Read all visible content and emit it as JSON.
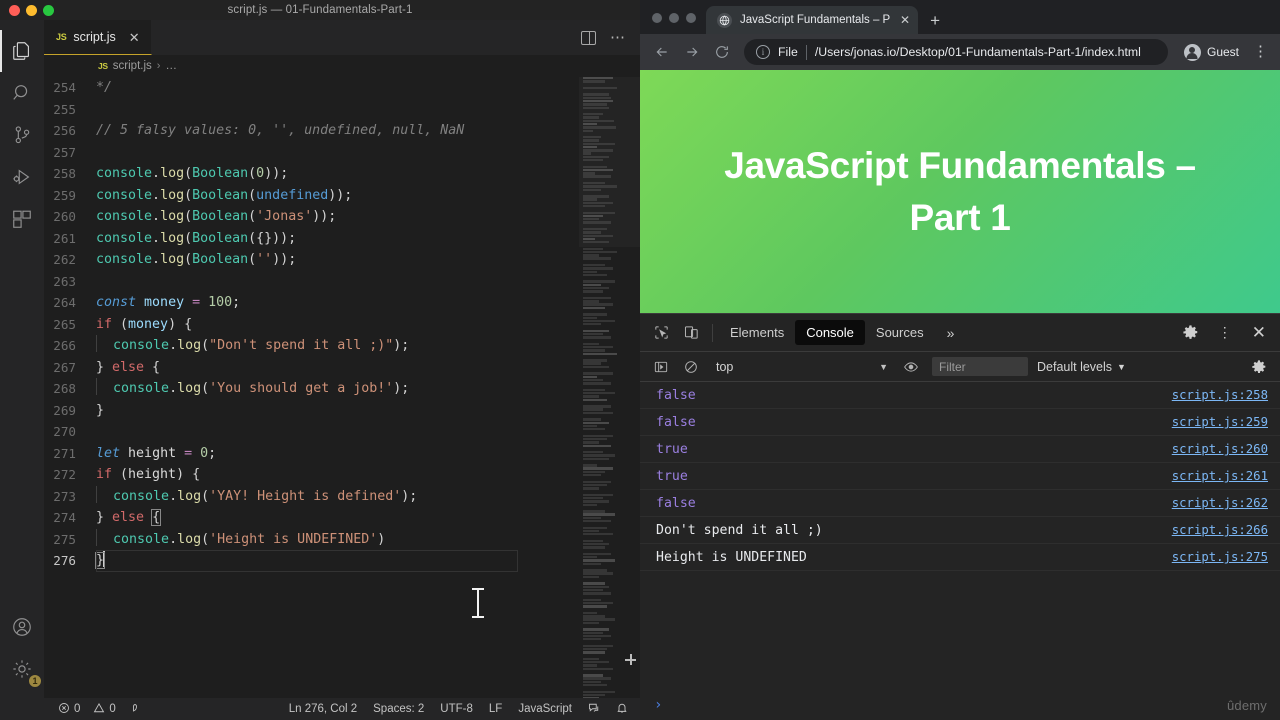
{
  "vscode": {
    "window_title": "script.js — 01-Fundamentals-Part-1",
    "tab": {
      "icon": "js-file-icon",
      "label": "script.js",
      "close": "✕"
    },
    "breadcrumb": {
      "file": "script.js",
      "separator": "›",
      "rest": "…"
    },
    "activity_items": [
      {
        "name": "explorer-icon",
        "label": "Explorer"
      },
      {
        "name": "search-icon",
        "label": "Search"
      },
      {
        "name": "source-control-icon",
        "label": "Source Control"
      },
      {
        "name": "run-debug-icon",
        "label": "Run and Debug"
      },
      {
        "name": "extensions-icon",
        "label": "Extensions"
      },
      {
        "name": "account-icon",
        "label": "Accounts"
      },
      {
        "name": "settings-gear-icon",
        "label": "Manage"
      }
    ],
    "settings_badge": "1",
    "editor_actions": {
      "split": "split-editor-icon",
      "more": "⋯"
    },
    "code": [
      {
        "n": "254",
        "tokens": [
          {
            "t": "cmt-gray",
            "v": "*/"
          }
        ]
      },
      {
        "n": "255",
        "tokens": []
      },
      {
        "n": "256",
        "tokens": [
          {
            "t": "cmt-gray",
            "v": "// 5 falsy values: 0, '', undefined, null, NaN"
          }
        ]
      },
      {
        "n": "257",
        "tokens": []
      },
      {
        "n": "258",
        "tokens": [
          {
            "t": "obj",
            "v": "console"
          },
          {
            "t": "pun",
            "v": "."
          },
          {
            "t": "fn",
            "v": "log"
          },
          {
            "t": "pun",
            "v": "("
          },
          {
            "t": "obj",
            "v": "Boolean"
          },
          {
            "t": "pun",
            "v": "("
          },
          {
            "t": "num",
            "v": "0"
          },
          {
            "t": "pun",
            "v": "));"
          }
        ]
      },
      {
        "n": "259",
        "tokens": [
          {
            "t": "obj",
            "v": "console"
          },
          {
            "t": "pun",
            "v": "."
          },
          {
            "t": "fn",
            "v": "log"
          },
          {
            "t": "pun",
            "v": "("
          },
          {
            "t": "obj",
            "v": "Boolean"
          },
          {
            "t": "pun",
            "v": "("
          },
          {
            "t": "und",
            "v": "undefined"
          },
          {
            "t": "pun",
            "v": "));"
          }
        ]
      },
      {
        "n": "260",
        "tokens": [
          {
            "t": "obj",
            "v": "console"
          },
          {
            "t": "pun",
            "v": "."
          },
          {
            "t": "fn",
            "v": "log"
          },
          {
            "t": "pun",
            "v": "("
          },
          {
            "t": "obj",
            "v": "Boolean"
          },
          {
            "t": "pun",
            "v": "("
          },
          {
            "t": "str",
            "v": "'Jonas'"
          },
          {
            "t": "pun",
            "v": "));"
          }
        ]
      },
      {
        "n": "261",
        "tokens": [
          {
            "t": "obj",
            "v": "console"
          },
          {
            "t": "pun",
            "v": "."
          },
          {
            "t": "fn",
            "v": "log"
          },
          {
            "t": "pun",
            "v": "("
          },
          {
            "t": "obj",
            "v": "Boolean"
          },
          {
            "t": "pun",
            "v": "({}));"
          }
        ]
      },
      {
        "n": "262",
        "tokens": [
          {
            "t": "obj",
            "v": "console"
          },
          {
            "t": "pun",
            "v": "."
          },
          {
            "t": "fn",
            "v": "log"
          },
          {
            "t": "pun",
            "v": "("
          },
          {
            "t": "obj",
            "v": "Boolean"
          },
          {
            "t": "pun",
            "v": "("
          },
          {
            "t": "str",
            "v": "''"
          },
          {
            "t": "pun",
            "v": "));"
          }
        ]
      },
      {
        "n": "263",
        "tokens": []
      },
      {
        "n": "264",
        "tokens": [
          {
            "t": "kwc",
            "v": "const"
          },
          {
            "t": "pun",
            "v": " "
          },
          {
            "t": "var",
            "v": "money"
          },
          {
            "t": "pun",
            "v": " "
          },
          {
            "t": "kw",
            "v": "="
          },
          {
            "t": "pun",
            "v": " "
          },
          {
            "t": "num",
            "v": "100"
          },
          {
            "t": "pun",
            "v": ";"
          }
        ]
      },
      {
        "n": "265",
        "tokens": [
          {
            "t": "kwi",
            "v": "if"
          },
          {
            "t": "pun",
            "v": " ("
          },
          {
            "t": "var",
            "v": "money"
          },
          {
            "t": "pun",
            "v": ") {"
          }
        ]
      },
      {
        "n": "266",
        "indent": 1,
        "tokens": [
          {
            "t": "obj",
            "v": "console"
          },
          {
            "t": "pun",
            "v": "."
          },
          {
            "t": "fn",
            "v": "log"
          },
          {
            "t": "pun",
            "v": "("
          },
          {
            "t": "str",
            "v": "\"Don't spend it all ;)\""
          },
          {
            "t": "pun",
            "v": ");"
          }
        ]
      },
      {
        "n": "267",
        "tokens": [
          {
            "t": "pun",
            "v": "} "
          },
          {
            "t": "kwi",
            "v": "else"
          },
          {
            "t": "pun",
            "v": " {"
          }
        ]
      },
      {
        "n": "268",
        "indent": 1,
        "tokens": [
          {
            "t": "obj",
            "v": "console"
          },
          {
            "t": "pun",
            "v": "."
          },
          {
            "t": "fn",
            "v": "log"
          },
          {
            "t": "pun",
            "v": "("
          },
          {
            "t": "str",
            "v": "'You should get a job!'"
          },
          {
            "t": "pun",
            "v": ");"
          }
        ]
      },
      {
        "n": "269",
        "tokens": [
          {
            "t": "pun",
            "v": "}"
          }
        ]
      },
      {
        "n": "270",
        "tokens": []
      },
      {
        "n": "271",
        "tokens": [
          {
            "t": "kwc",
            "v": "let"
          },
          {
            "t": "pun",
            "v": " "
          },
          {
            "t": "id",
            "v": "height"
          },
          {
            "t": "pun",
            "v": " "
          },
          {
            "t": "kw",
            "v": "="
          },
          {
            "t": "pun",
            "v": " "
          },
          {
            "t": "num",
            "v": "0"
          },
          {
            "t": "pun",
            "v": ";"
          }
        ]
      },
      {
        "n": "272",
        "tokens": [
          {
            "t": "kwi",
            "v": "if"
          },
          {
            "t": "pun",
            "v": " ("
          },
          {
            "t": "id",
            "v": "height"
          },
          {
            "t": "pun",
            "v": ") {"
          }
        ]
      },
      {
        "n": "273",
        "indent": 1,
        "tokens": [
          {
            "t": "obj",
            "v": "console"
          },
          {
            "t": "pun",
            "v": "."
          },
          {
            "t": "fn",
            "v": "log"
          },
          {
            "t": "pun",
            "v": "("
          },
          {
            "t": "str",
            "v": "'YAY! Height is defined'"
          },
          {
            "t": "pun",
            "v": ");"
          }
        ]
      },
      {
        "n": "274",
        "tokens": [
          {
            "t": "pun",
            "v": "} "
          },
          {
            "t": "kwi",
            "v": "else"
          },
          {
            "t": "pun",
            "v": " "
          },
          {
            "t": "brk",
            "v": "{"
          }
        ]
      },
      {
        "n": "275",
        "indent": 1,
        "tokens": [
          {
            "t": "obj",
            "v": "console"
          },
          {
            "t": "pun",
            "v": "."
          },
          {
            "t": "fn",
            "v": "log"
          },
          {
            "t": "pun",
            "v": "("
          },
          {
            "t": "str",
            "v": "'Height is UNDEFINED'"
          },
          {
            "t": "pun",
            "v": ")"
          }
        ]
      },
      {
        "n": "276",
        "current": true,
        "tokens": [
          {
            "t": "brk",
            "v": "}"
          }
        ]
      }
    ],
    "statusbar": {
      "errors": "0",
      "warnings": "0",
      "ports_icon": "ports-icon",
      "position": "Ln 276, Col 2",
      "spaces": "Spaces: 2",
      "encoding": "UTF-8",
      "eol": "LF",
      "language": "JavaScript",
      "feedback_icon": "feedback-icon",
      "bell_icon": "notifications-icon"
    }
  },
  "chrome": {
    "tab": {
      "title": "JavaScript Fundamentals – Par",
      "favicon": "globe-icon",
      "close": "✕"
    },
    "new_tab": "+",
    "nav": {
      "back": "←",
      "forward": "→",
      "reload": "⟳"
    },
    "omnibox": {
      "info_icon": "ⓘ",
      "scheme_label": "File",
      "url": "/Users/jonas.io/Desktop/01-Fundamentals-Part-1/index.html"
    },
    "profile": {
      "icon": "guest-avatar-icon",
      "label": "Guest"
    },
    "menu": "⋮",
    "page": {
      "heading": "JavaScript Fundamentals – Part 1",
      "gradient_from": "#7ed957",
      "gradient_to": "#3fc98c"
    },
    "watermark": "ûdemy"
  },
  "devtools": {
    "toolbar": {
      "inspect_icon": "inspect-element-icon",
      "device_icon": "device-toolbar-icon",
      "tabs": [
        {
          "label": "Elements",
          "active": false
        },
        {
          "label": "Console",
          "active": true
        },
        {
          "label": "Sources",
          "active": false
        }
      ],
      "overflow": "»",
      "settings_icon": "settings-gear-icon",
      "kebab_icon": "more-options-icon",
      "close_icon": "close-devtools-icon"
    },
    "filterbar": {
      "sidebar_icon": "console-sidebar-icon",
      "clear_icon": "clear-console-icon",
      "context": "top",
      "context_caret": "▼",
      "eye_icon": "live-expression-icon",
      "filter_placeholder": "Filter",
      "levels": "Default levels",
      "levels_caret": "▼",
      "settings_icon": "console-settings-icon"
    },
    "console_rows": [
      {
        "value": "false",
        "kind": "bool",
        "source": "script.js:258"
      },
      {
        "value": "false",
        "kind": "bool",
        "source": "script.js:259"
      },
      {
        "value": "true",
        "kind": "bool",
        "source": "script.js:260"
      },
      {
        "value": "true",
        "kind": "bool",
        "source": "script.js:261"
      },
      {
        "value": "false",
        "kind": "bool",
        "source": "script.js:262"
      },
      {
        "value": "Don't spend it all ;)",
        "kind": "str",
        "source": "script.js:266"
      },
      {
        "value": "Height is UNDEFINED",
        "kind": "str",
        "source": "script.js:275"
      }
    ],
    "prompt": "›"
  }
}
